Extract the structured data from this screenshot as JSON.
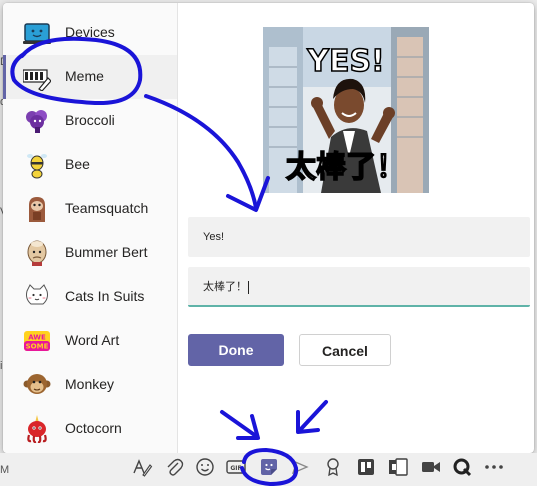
{
  "sidebar": {
    "items": [
      {
        "label": "Devices",
        "icon": "devices-icon"
      },
      {
        "label": "Meme",
        "icon": "meme-icon",
        "active": true
      },
      {
        "label": "Broccoli",
        "icon": "broccoli-icon"
      },
      {
        "label": "Bee",
        "icon": "bee-icon"
      },
      {
        "label": "Teamsquatch",
        "icon": "teamsquatch-icon"
      },
      {
        "label": "Bummer Bert",
        "icon": "bummer-bert-icon"
      },
      {
        "label": "Cats In Suits",
        "icon": "cats-in-suits-icon"
      },
      {
        "label": "Word Art",
        "icon": "word-art-icon"
      },
      {
        "label": "Monkey",
        "icon": "monkey-icon"
      },
      {
        "label": "Octocorn",
        "icon": "octocorn-icon"
      }
    ]
  },
  "meme": {
    "top_text": "YES!",
    "bottom_text": "太棒了！"
  },
  "form": {
    "top_value": "Yes!",
    "bottom_value": "太棒了！"
  },
  "buttons": {
    "done": "Done",
    "cancel": "Cancel"
  },
  "word_art_text": [
    "AWE",
    "SOME"
  ],
  "gif_label": "GIF",
  "edge_letters": [
    "D",
    "d",
    "V",
    "i",
    "M"
  ],
  "toolbar_icons": [
    "format-icon",
    "attach-icon",
    "emoji-icon",
    "gif-icon",
    "sticker-icon",
    "send-icon",
    "praise-icon",
    "planner-icon",
    "forms-icon",
    "meet-now-icon",
    "q-icon",
    "more-icon"
  ],
  "colors": {
    "accent": "#6264a7",
    "annotation": "#1a14d8",
    "focus_underline": "#5fb3a8"
  }
}
